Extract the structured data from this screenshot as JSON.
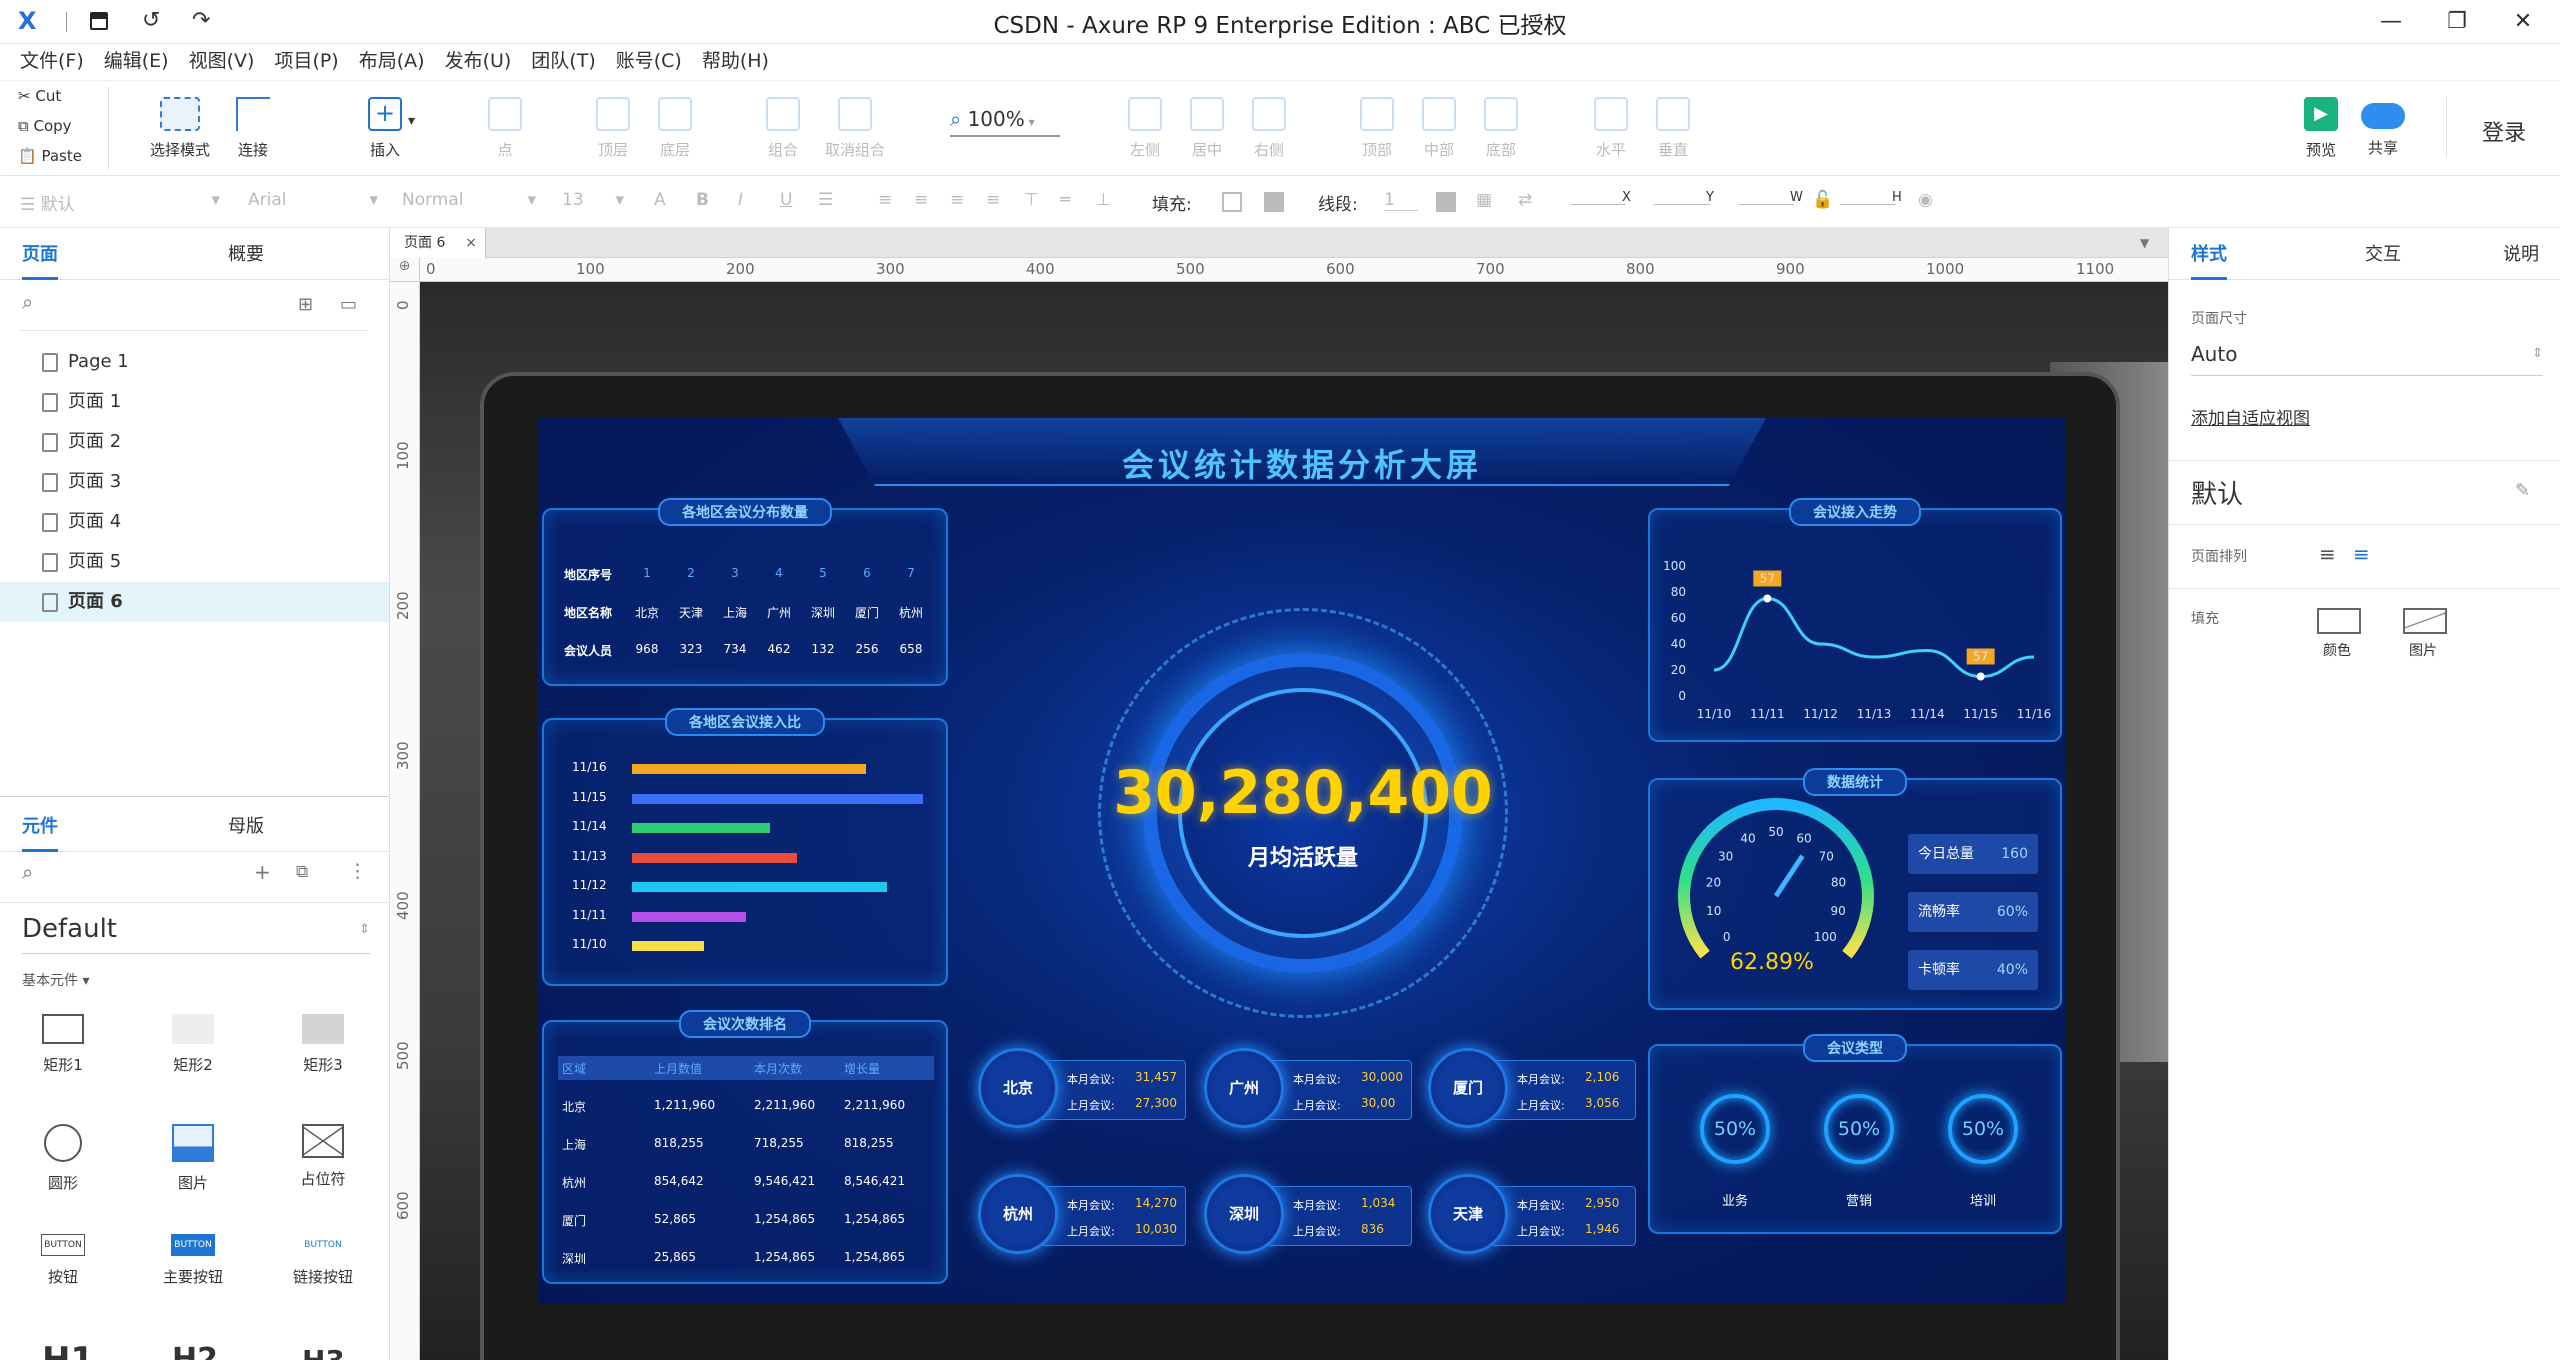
{
  "window": {
    "title": "CSDN - Axure RP 9 Enterprise Edition : ABC  已授权"
  },
  "menu": [
    "文件(F)",
    "编辑(E)",
    "视图(V)",
    "项目(P)",
    "布局(A)",
    "发布(U)",
    "团队(T)",
    "账号(C)",
    "帮助(H)"
  ],
  "clipboard": {
    "cut": "Cut",
    "copy": "Copy",
    "paste": "Paste"
  },
  "toolbar": {
    "select_mode": "选择模式",
    "connect": "连接",
    "insert": "插入",
    "point": "点",
    "top_layer": "顶层",
    "bottom_layer": "底层",
    "group": "组合",
    "ungroup": "取消组合",
    "zoom": "100%",
    "align_left": "左侧",
    "align_center": "居中",
    "align_right": "右侧",
    "align_top": "顶部",
    "align_middle": "中部",
    "align_bottom": "底部",
    "dist_h": "水平",
    "dist_v": "垂直",
    "preview": "预览",
    "share": "共享",
    "login": "登录"
  },
  "format": {
    "style": "默认",
    "font": "Arial",
    "weight": "Normal",
    "size": "13",
    "fill": "填充:",
    "line": "线段:",
    "line_value": "1",
    "x": "X",
    "y": "Y",
    "w": "W",
    "h": "H"
  },
  "left": {
    "tab_pages": "页面",
    "tab_outline": "概要",
    "pages": [
      "Page 1",
      "页面 1",
      "页面 2",
      "页面 3",
      "页面 4",
      "页面 5",
      "页面 6"
    ],
    "tab_widgets": "元件",
    "tab_masters": "母版",
    "library": "Default",
    "category": "基本元件 ▾",
    "widgets": [
      "矩形1",
      "矩形2",
      "矩形3",
      "圆形",
      "图片",
      "占位符",
      "按钮",
      "主要按钮",
      "链接按钮"
    ],
    "button_text": "BUTTON",
    "headings": [
      "H1",
      "H2",
      "H3"
    ]
  },
  "canvas": {
    "tab": "页面 6",
    "ruler_top": [
      "0",
      "100",
      "200",
      "300",
      "400",
      "500",
      "600",
      "700",
      "800",
      "900",
      "1000",
      "1100"
    ],
    "ruler_left": [
      "0",
      "100",
      "200",
      "300",
      "400",
      "500",
      "600"
    ]
  },
  "right": {
    "tab_style": "样式",
    "tab_interact": "交互",
    "tab_notes": "说明",
    "page_size_label": "页面尺寸",
    "page_size": "Auto",
    "adaptive": "添加自适应视图",
    "default": "默认",
    "page_align": "页面排列",
    "fill": "填充",
    "fill_color": "颜色",
    "fill_image": "图片"
  },
  "dashboard": {
    "title": "会议统计数据分析大屏",
    "center_value": "30,280,400",
    "center_label": "月均活跃量",
    "p1": {
      "title": "各地区会议分布数量",
      "row_labels": [
        "地区序号",
        "地区名称",
        "会议人员"
      ],
      "ids": [
        "1",
        "2",
        "3",
        "4",
        "5",
        "6",
        "7"
      ],
      "cities": [
        "北京",
        "天津",
        "上海",
        "广州",
        "深圳",
        "厦门",
        "杭州"
      ],
      "people": [
        "968",
        "323",
        "734",
        "462",
        "132",
        "256",
        "658"
      ]
    },
    "p2": {
      "title": "各地区会议接入比",
      "dates": [
        "11/16",
        "11/15",
        "11/14",
        "11/13",
        "11/12",
        "11/11",
        "11/10"
      ],
      "values": [
        0.78,
        0.97,
        0.46,
        0.55,
        0.85,
        0.38,
        0.24
      ],
      "colors": [
        "#f5a623",
        "#3b6ff5",
        "#2ecc71",
        "#e74c3c",
        "#1fc8f0",
        "#b44fe8",
        "#f5e04a"
      ]
    },
    "p3": {
      "title": "会议次数排名",
      "headers": [
        "区域",
        "上月数值",
        "本月次数",
        "增长量"
      ],
      "rows": [
        [
          "北京",
          "1,211,960",
          "2,211,960",
          "2,211,960"
        ],
        [
          "上海",
          "818,255",
          "718,255",
          "818,255"
        ],
        [
          "杭州",
          "854,642",
          "9,546,421",
          "8,546,421"
        ],
        [
          "厦门",
          "52,865",
          "1,254,865",
          "1,254,865"
        ],
        [
          "深圳",
          "25,865",
          "1,254,865",
          "1,254,865"
        ]
      ]
    },
    "cities": [
      {
        "name": "北京",
        "this_label": "本月会议:",
        "this": "31,457",
        "last_label": "上月会议:",
        "last": "27,300"
      },
      {
        "name": "广州",
        "this_label": "本月会议:",
        "this": "30,000",
        "last_label": "上月会议:",
        "last": "30,00"
      },
      {
        "name": "厦门",
        "this_label": "本月会议:",
        "this": "2,106",
        "last_label": "上月会议:",
        "last": "3,056"
      },
      {
        "name": "杭州",
        "this_label": "本月会议:",
        "this": "14,270",
        "last_label": "上月会议:",
        "last": "10,030"
      },
      {
        "name": "深圳",
        "this_label": "本月会议:",
        "this": "1,034",
        "last_label": "上月会议:",
        "last": "836"
      },
      {
        "name": "天津",
        "this_label": "本月会议:",
        "this": "2,950",
        "last_label": "上月会议:",
        "last": "1,946"
      }
    ],
    "p4": {
      "title": "会议接入走势",
      "y": [
        "100",
        "80",
        "60",
        "40",
        "20",
        "0"
      ],
      "x": [
        "11/10",
        "11/11",
        "11/12",
        "11/13",
        "11/14",
        "11/15",
        "11/16"
      ],
      "values": [
        20,
        75,
        40,
        30,
        35,
        15,
        30
      ],
      "marker_text": "57"
    },
    "p5": {
      "title": "数据统计",
      "gauge_ticks": [
        "0",
        "10",
        "20",
        "30",
        "40",
        "50",
        "60",
        "70",
        "80",
        "90",
        "100"
      ],
      "gauge_value": "62.89%",
      "stats": [
        {
          "label": "今日总量",
          "value": "160"
        },
        {
          "label": "流畅率",
          "value": "60%"
        },
        {
          "label": "卡顿率",
          "value": "40%"
        }
      ]
    },
    "p6": {
      "title": "会议类型",
      "rings": [
        {
          "value": "50%",
          "label": "业务"
        },
        {
          "value": "50%",
          "label": "营销"
        },
        {
          "value": "50%",
          "label": "培训"
        }
      ]
    }
  },
  "colors": {
    "accent": "#1e76d2",
    "screen_bg": "#06206a",
    "gold": "#ffd200",
    "cyan": "#3fd0ff"
  }
}
